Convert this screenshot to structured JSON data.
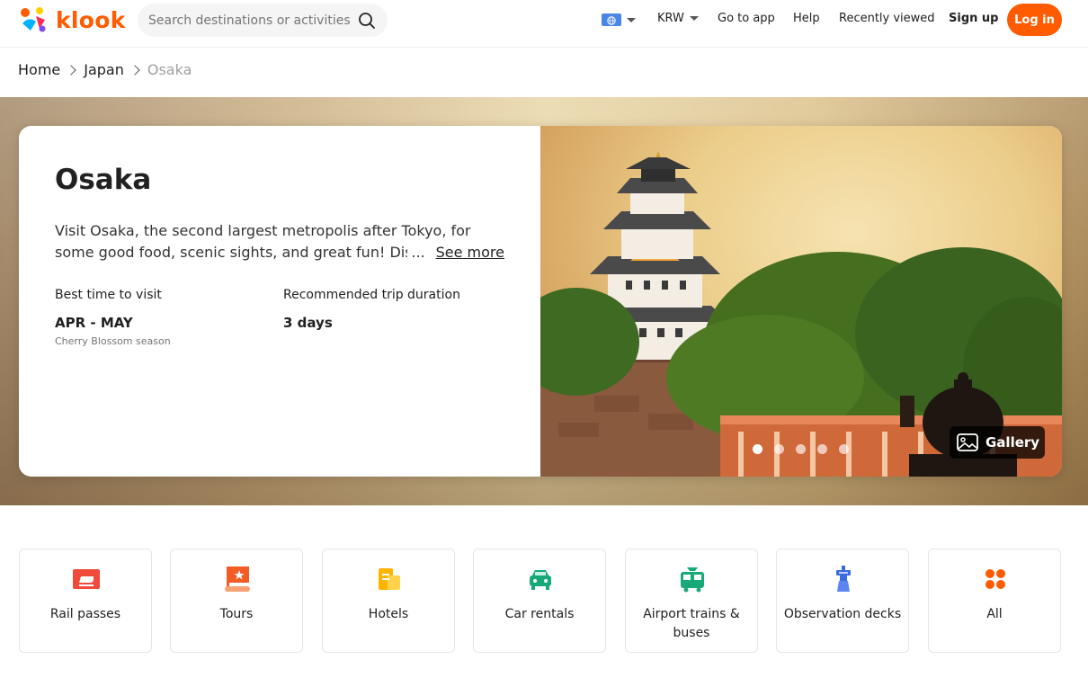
{
  "header": {
    "logo_text": "klook",
    "search_placeholder": "Search destinations or activities",
    "currency": "KRW",
    "go_to_app": "Go to app",
    "help": "Help",
    "recently_viewed": "Recently viewed",
    "sign_up": "Sign up",
    "log_in": "Log in",
    "accent_color": "#ff5b00"
  },
  "breadcrumb": [
    "Home",
    "Japan",
    "Osaka"
  ],
  "destination": {
    "title": "Osaka",
    "description_line1": "Visit Osaka, the second largest metropolis after Tokyo, for",
    "description_line2": "some good food, scenic sights, and great fun! Discover",
    "ellipsis": "...",
    "see_more": "See more",
    "best_time_label": "Best time to visit",
    "best_time_value": "APR - MAY",
    "best_time_note": "Cherry Blossom season",
    "trip_duration_label": "Recommended trip duration",
    "trip_duration_value": "3 days"
  },
  "gallery": {
    "button_label": "Gallery",
    "slide_count": 5,
    "active_slide": 1
  },
  "categories": [
    {
      "label": "Rail passes",
      "icon": "rail-pass-icon"
    },
    {
      "label": "Tours",
      "icon": "tour-flag-icon"
    },
    {
      "label": "Hotels",
      "icon": "hotel-icon"
    },
    {
      "label": "Car rentals",
      "icon": "car-icon"
    },
    {
      "label": "Airport trains & buses",
      "icon": "airport-bus-icon"
    },
    {
      "label": "Observation decks",
      "icon": "observation-tower-icon"
    },
    {
      "label": "All",
      "icon": "grid-dots-icon"
    }
  ]
}
